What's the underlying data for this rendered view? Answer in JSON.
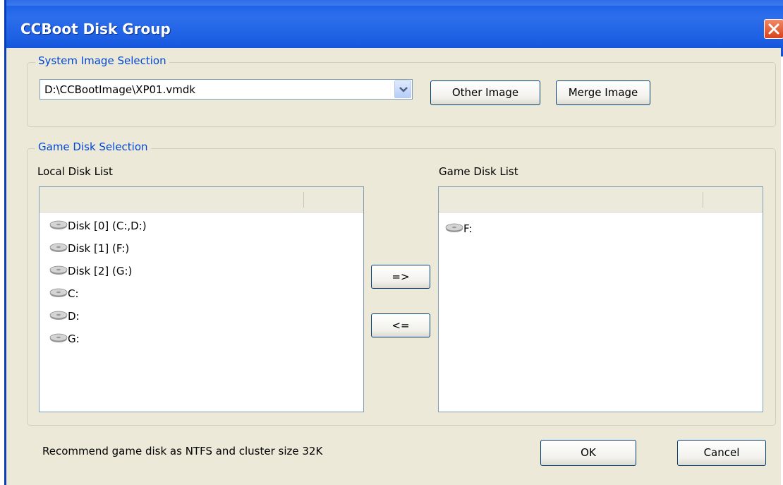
{
  "window": {
    "title": "CCBoot Disk Group",
    "close_icon": "close-icon"
  },
  "system_image": {
    "legend": "System Image Selection",
    "selected_image": "D:\\CCBootImage\\XP01.vmdk",
    "other_image_label": "Other Image",
    "merge_image_label": "Merge Image"
  },
  "game_disk": {
    "legend": "Game Disk Selection",
    "local_list_label": "Local Disk List",
    "game_list_label": "Game Disk List",
    "local_items": [
      "Disk [0] (C:,D:)",
      "Disk [1] (F:)",
      "Disk [2] (G:)",
      "C:",
      "D:",
      "G:"
    ],
    "game_items": [
      "F:"
    ],
    "add_label": "=>",
    "remove_label": "<="
  },
  "footer": {
    "hint": "Recommend game disk as NTFS and cluster size 32K",
    "ok_label": "OK",
    "cancel_label": "Cancel"
  },
  "colors": {
    "titlebar": "#0a54e6",
    "client_bg": "#ece9d8",
    "legend_text": "#0046d5"
  }
}
